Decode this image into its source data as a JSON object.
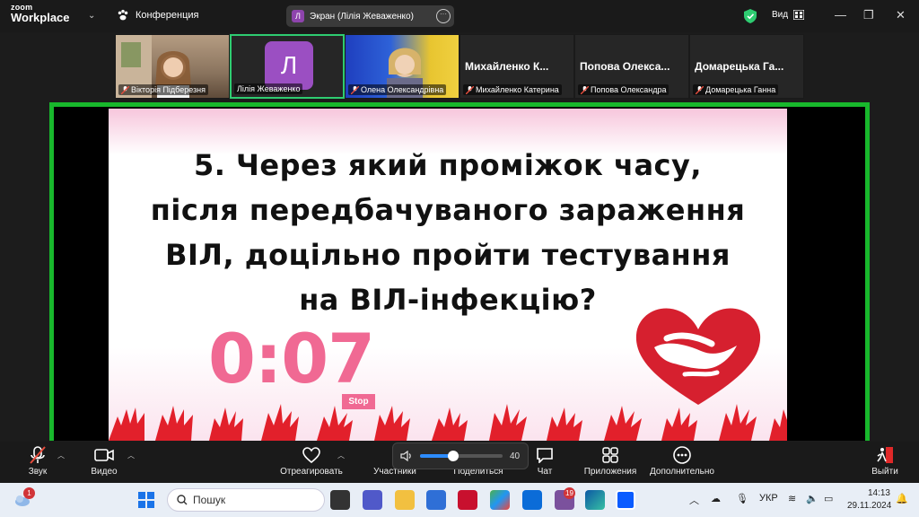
{
  "app": {
    "logo_top": "zoom",
    "logo_bottom": "Workplace",
    "conference_label": "Конференция",
    "screen_tab": {
      "avatar_letter": "Л",
      "label": "Экран (Лілія Жеваженко)"
    },
    "view_label": "Вид",
    "accent_green": "#18b82c"
  },
  "participants": [
    {
      "name": "Вікторія Підберезня",
      "muted": true,
      "kind": "video"
    },
    {
      "name": "Лілія Жеваженко",
      "avatar_letter": "Л",
      "muted": false,
      "kind": "avatar",
      "active": true
    },
    {
      "name": "Олена Олександрівна",
      "muted": true,
      "kind": "video"
    },
    {
      "big_name": "Михайленко  К...",
      "name": "Михайленко Катерина",
      "muted": true,
      "kind": "name"
    },
    {
      "big_name": "Попова  Олекса...",
      "name": "Попова Олександра",
      "muted": true,
      "kind": "name"
    },
    {
      "big_name": "Домарецька  Га...",
      "name": "Домарецька Ганна",
      "muted": true,
      "kind": "name"
    }
  ],
  "slide": {
    "question_lines": [
      "5. Через який проміжок часу,",
      "після передбачуваного зараження",
      "ВІЛ, доцільно пройти тестування",
      "на ВІЛ-інфекцію?"
    ],
    "timer": "0:07",
    "stop_label": "Stop",
    "accent_pink": "#f06993"
  },
  "volume": {
    "value": "40",
    "level": 0.4
  },
  "toolbar": {
    "audio": "Звук",
    "video": "Видео",
    "react": "Отреагировать",
    "participants": "Участники",
    "share": "Поделиться",
    "chat": "Чат",
    "apps": "Приложения",
    "more": "Дополнительно",
    "leave": "Выйти"
  },
  "taskbar": {
    "weather_badge": "1",
    "search_placeholder": "Пошук",
    "viber_badge": "19",
    "lang": "УКР",
    "time": "14:13",
    "date": "29.11.2024"
  }
}
